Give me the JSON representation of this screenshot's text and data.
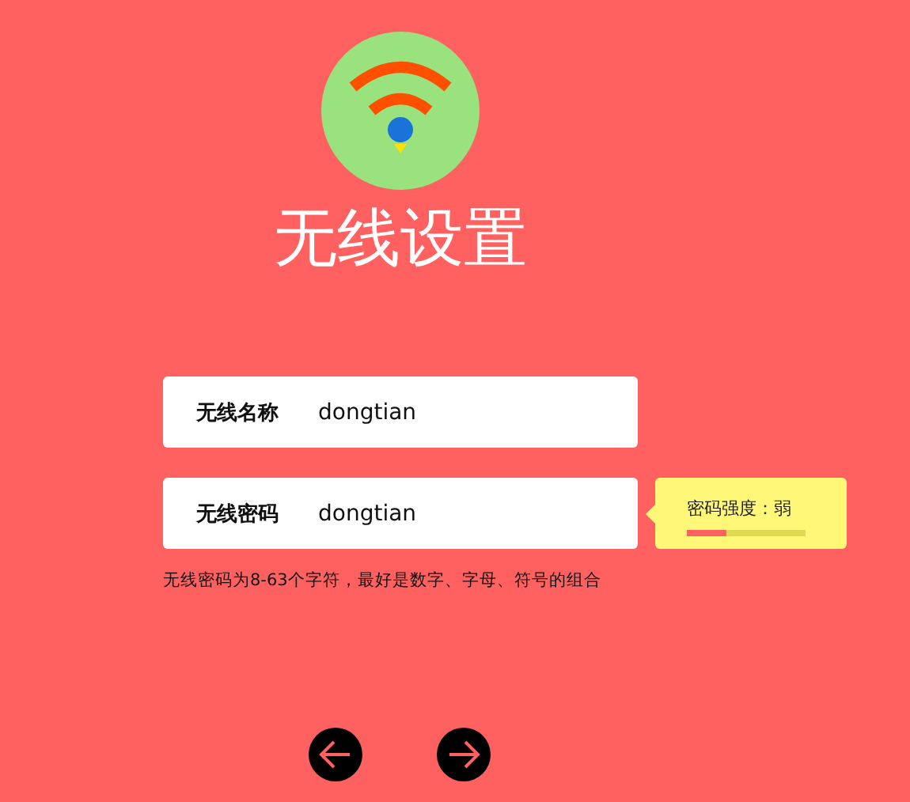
{
  "title": "无线设置",
  "fields": [
    {
      "label": "无线名称",
      "value": "dongtian"
    },
    {
      "label": "无线密码",
      "value": "dongtian"
    }
  ],
  "strength": {
    "label": "密码强度：弱",
    "level": 0.33
  },
  "hint": "无线密码为8-63个字符，最好是数字、字母、符号的组合"
}
